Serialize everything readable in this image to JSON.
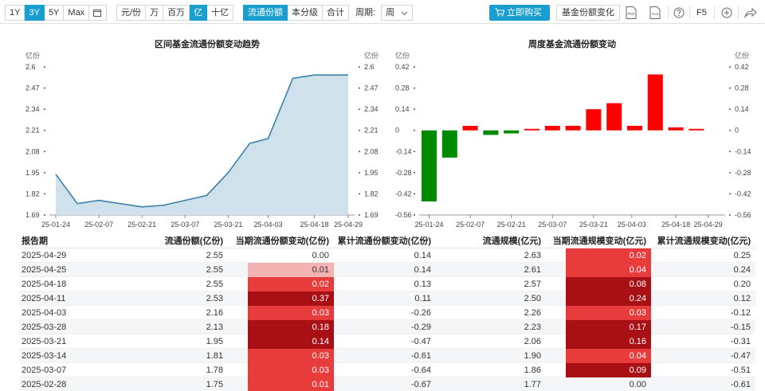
{
  "toolbar": {
    "periods": [
      "1Y",
      "3Y",
      "5Y",
      "Max"
    ],
    "period_active": 1,
    "units": [
      "元/份",
      "万",
      "百万",
      "亿",
      "十亿"
    ],
    "unit_active": 3,
    "share_types": [
      "流通份额",
      "本分级",
      "合计"
    ],
    "share_active": 0,
    "cycle_label": "周期:",
    "cycle_value": "周",
    "buy_label": "立即购买",
    "feature_label": "基金份额变化",
    "f5_label": "F5",
    "pdf_label": "PDF",
    "xls_label": "XLS"
  },
  "colors": {
    "accent": "#1a9ecf",
    "line": "#3d82ab",
    "area": "#cfe2ec",
    "pos": "#ff0000",
    "neg": "#008a00",
    "heat_light": "#f4b3b3",
    "heat_mid": "#e83b3b",
    "heat_dark": "#a81016"
  },
  "chart_data": [
    {
      "type": "area",
      "title": "区间基金流通份额变动趋势",
      "ylabel": "亿份",
      "ylabel_right": "亿份",
      "ylim": [
        1.69,
        2.6
      ],
      "yticks": [
        "2.6",
        "2.47",
        "2.34",
        "2.21",
        "2.08",
        "1.95",
        "1.82",
        "1.69"
      ],
      "ytick_values": [
        2.6,
        2.47,
        2.34,
        2.21,
        2.08,
        1.95,
        1.82,
        1.69
      ],
      "xticks": [
        "25-01-24",
        "25-02-07",
        "25-02-21",
        "25-03-07",
        "25-03-21",
        "25-04-03",
        "25-04-18",
        "25-04-29"
      ],
      "x": [
        "2025-01-24",
        "2025-01-31",
        "2025-02-07",
        "2025-02-14",
        "2025-02-21",
        "2025-02-28",
        "2025-03-07",
        "2025-03-14",
        "2025-03-21",
        "2025-03-28",
        "2025-04-03",
        "2025-04-11",
        "2025-04-18",
        "2025-04-25",
        "2025-04-29"
      ],
      "values": [
        1.94,
        1.76,
        1.78,
        1.76,
        1.74,
        1.75,
        1.78,
        1.81,
        1.95,
        2.13,
        2.16,
        2.53,
        2.55,
        2.55,
        2.55
      ],
      "grid": false,
      "legend": "none"
    },
    {
      "type": "bar",
      "title": "周度基金流通份额变动",
      "ylabel": "亿份",
      "ylabel_right": "亿份",
      "ylim": [
        -0.56,
        0.42
      ],
      "yticks": [
        "0.42",
        "0.28",
        "0.14",
        "0",
        "-0.14",
        "-0.28",
        "-0.42",
        "-0.56"
      ],
      "ytick_values": [
        0.42,
        0.28,
        0.14,
        0,
        -0.14,
        -0.28,
        -0.42,
        -0.56
      ],
      "xticks": [
        "25-01-24",
        "25-02-07",
        "25-02-21",
        "25-03-07",
        "25-03-21",
        "25-04-03",
        "25-04-18",
        "25-04-29"
      ],
      "x": [
        "2025-01-24",
        "2025-01-31",
        "2025-02-07",
        "2025-02-14",
        "2025-02-21",
        "2025-02-28",
        "2025-03-07",
        "2025-03-14",
        "2025-03-21",
        "2025-03-28",
        "2025-04-03",
        "2025-04-11",
        "2025-04-18",
        "2025-04-25"
      ],
      "values": [
        -0.47,
        -0.18,
        0.03,
        -0.03,
        -0.02,
        0.01,
        0.03,
        0.03,
        0.14,
        0.18,
        0.03,
        0.37,
        0.02,
        0.01
      ],
      "grid": false,
      "legend": "none"
    }
  ],
  "table": {
    "headers": [
      "报告期",
      "流通份额(亿份)",
      "当期流通份额变动(亿份)",
      "累计流通份额变动(亿份)",
      "流通规模(亿元)",
      "当期流通规模变动(亿元)",
      "累计流通规模变动(亿元)"
    ],
    "rows": [
      [
        "2025-04-29",
        "2.55",
        "0.00",
        "0.14",
        "2.63",
        "0.02",
        "0.25"
      ],
      [
        "2025-04-25",
        "2.55",
        "0.01",
        "0.14",
        "2.61",
        "0.04",
        "0.24"
      ],
      [
        "2025-04-18",
        "2.55",
        "0.02",
        "0.13",
        "2.57",
        "0.08",
        "0.20"
      ],
      [
        "2025-04-11",
        "2.53",
        "0.37",
        "0.11",
        "2.50",
        "0.24",
        "0.12"
      ],
      [
        "2025-04-03",
        "2.16",
        "0.03",
        "-0.26",
        "2.26",
        "0.03",
        "-0.12"
      ],
      [
        "2025-03-28",
        "2.13",
        "0.18",
        "-0.29",
        "2.23",
        "0.17",
        "-0.15"
      ],
      [
        "2025-03-21",
        "1.95",
        "0.14",
        "-0.47",
        "2.06",
        "0.16",
        "-0.31"
      ],
      [
        "2025-03-14",
        "1.81",
        "0.03",
        "-0.61",
        "1.90",
        "0.04",
        "-0.47"
      ],
      [
        "2025-03-07",
        "1.78",
        "0.03",
        "-0.64",
        "1.86",
        "0.09",
        "-0.51"
      ],
      [
        "2025-02-28",
        "1.75",
        "0.01",
        "-0.67",
        "1.77",
        "0.00",
        "-0.61"
      ]
    ],
    "heat_share": [
      "none",
      "light",
      "mid",
      "dark",
      "mid",
      "dark",
      "dark",
      "mid",
      "mid",
      "mid"
    ],
    "heat_scale": [
      "mid",
      "mid",
      "dark",
      "dark",
      "mid",
      "dark",
      "dark",
      "mid",
      "dark",
      "none"
    ]
  }
}
